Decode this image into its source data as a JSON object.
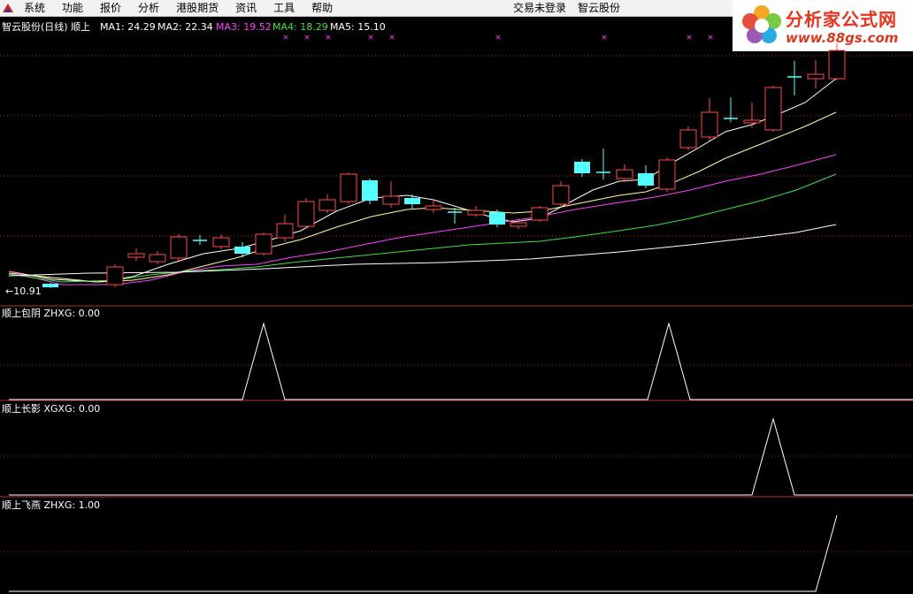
{
  "menu": {
    "items": [
      "系统",
      "功能",
      "报价",
      "分析",
      "港股期货",
      "资讯",
      "工具",
      "帮助"
    ],
    "trade_status": "交易未登录",
    "stock_name": "智云股份"
  },
  "brand": {
    "name": "分析家公式网",
    "url": "www.88gs.com"
  },
  "main_panel": {
    "title": "智云股份(日线) 顺上",
    "ma_labels": [
      {
        "text": "MA1: 24.29",
        "color": "#ffffff"
      },
      {
        "text": "MA2: 22.34",
        "color": "#ffffff"
      },
      {
        "text": "MA3: 19.52",
        "color": "#ff40ff"
      },
      {
        "text": "MA4: 18.29",
        "color": "#40e040"
      },
      {
        "text": "MA5: 15.10",
        "color": "#ffffff"
      }
    ],
    "low_marker": "←10.91",
    "signal_glyph": "×"
  },
  "sub_panels": [
    {
      "title": "顺上包阴  ZHXG: 0.00"
    },
    {
      "title": "顺上长影  XGXG: 0.00"
    },
    {
      "title": "顺上飞燕  ZHXG: 1.00"
    }
  ],
  "colors": {
    "up": "#ff4a4a",
    "down": "#54ffff",
    "grid": "#aa2222",
    "ma1": "#ffffff",
    "ma2": "#ffff99",
    "ma3": "#ff40ff",
    "ma4": "#40e040",
    "ma5": "#ffffff"
  }
}
